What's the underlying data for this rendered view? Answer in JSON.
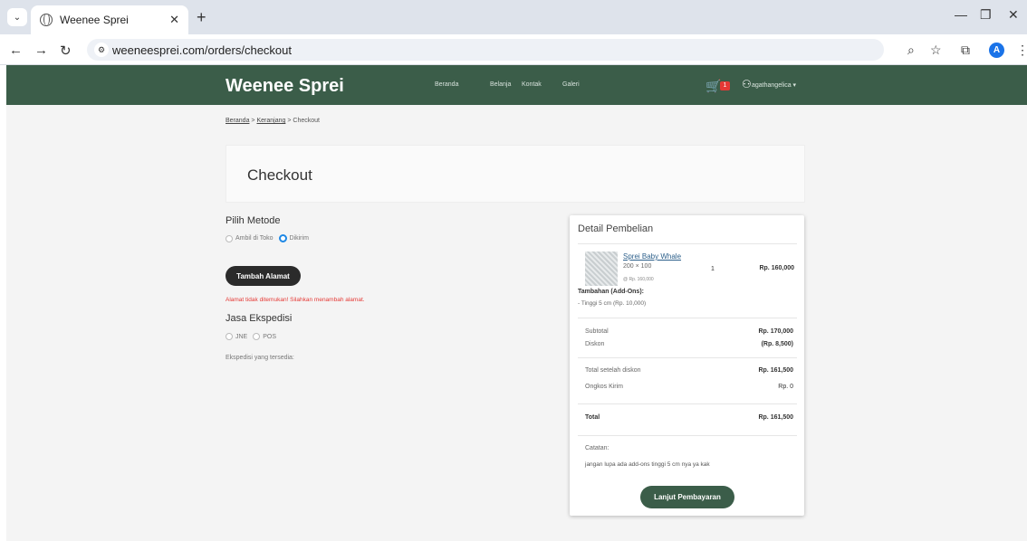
{
  "browser": {
    "tab_title": "Weenee Sprei",
    "url": "weeneesprei.com/orders/checkout",
    "profile_initial": "A"
  },
  "header": {
    "brand": "Weenee Sprei",
    "nav": [
      "Beranda",
      "Belanja",
      "Kontak",
      "Galeri"
    ],
    "cart_count": "1",
    "username": "agathangelica"
  },
  "breadcrumb": {
    "home": "Beranda",
    "sep1": ">",
    "cart": "Keranjang",
    "sep2": ">",
    "current": "Checkout"
  },
  "page_title": "Checkout",
  "method": {
    "title": "Pilih Metode",
    "options": [
      "Ambil di Toko",
      "Dikirim"
    ],
    "selected": "Dikirim",
    "add_address_button": "Tambah Alamat",
    "error": "Alamat tidak ditemukan! Silahkan menambah alamat."
  },
  "shipping": {
    "title": "Jasa Ekspedisi",
    "options": [
      "JNE",
      "POS"
    ],
    "available_label": "Ekspedisi yang tersedia:"
  },
  "order": {
    "title": "Detail Pembelian",
    "product": {
      "name": "Sprei Baby Whale",
      "size": "200 × 100",
      "unit_price": "@ Rp. 160,000",
      "qty": "1",
      "price": "Rp. 160,000"
    },
    "addons_title": "Tambahan (Add-Ons):",
    "addons": [
      "- Tinggi 5 cm (Rp. 10,000)"
    ],
    "subtotal_label": "Subtotal",
    "subtotal": "Rp. 170,000",
    "discount_label": "Diskon",
    "discount": "(Rp. 8,500)",
    "after_discount_label": "Total setelah diskon",
    "after_discount": "Rp. 161,500",
    "shipping_label": "Ongkos Kirim",
    "shipping": "Rp. 0",
    "total_label": "Total",
    "total": "Rp. 161,500",
    "note_label": "Catatan:",
    "note": "jangan lupa ada add-ons tinggi 5 cm nya ya kak",
    "pay_button": "Lanjut Pembayaran"
  },
  "colors": {
    "brand_green": "#3b5d49",
    "error_red": "#e53935",
    "radio_blue": "#1e88e5"
  }
}
